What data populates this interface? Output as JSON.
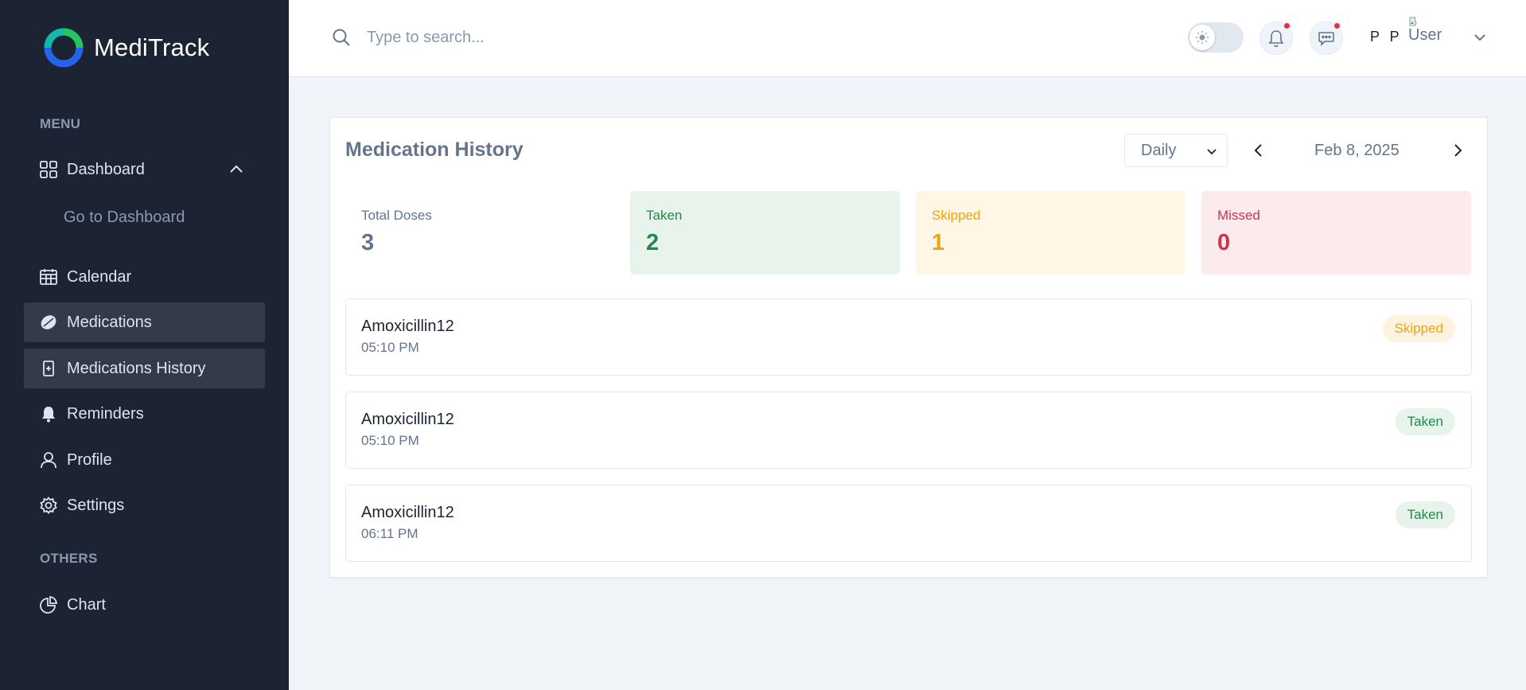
{
  "sidebar": {
    "brand": "MediTrack",
    "menu_title": "MENU",
    "others_title": "OTHERS",
    "items": [
      {
        "label": "Dashboard",
        "icon": "grid-icon"
      },
      {
        "label": "Go to Dashboard"
      },
      {
        "label": "Calendar",
        "icon": "calendar-icon"
      },
      {
        "label": "Medications",
        "icon": "pill-icon",
        "active": true
      },
      {
        "label": "Medications History",
        "icon": "history-icon",
        "active": true
      },
      {
        "label": "Reminders",
        "icon": "bell-icon"
      },
      {
        "label": "Profile",
        "icon": "user-icon"
      },
      {
        "label": "Settings",
        "icon": "gear-icon"
      },
      {
        "label": "Chart",
        "icon": "pie-chart-icon"
      }
    ]
  },
  "header": {
    "search_placeholder": "Type to search...",
    "user_initials": "P P",
    "avatar_alt": "User"
  },
  "main": {
    "title": "Medication History",
    "period": "Daily",
    "date": "Feb 8, 2025",
    "stats": {
      "total": {
        "label": "Total Doses",
        "value": "3"
      },
      "taken": {
        "label": "Taken",
        "value": "2"
      },
      "skipped": {
        "label": "Skipped",
        "value": "1"
      },
      "missed": {
        "label": "Missed",
        "value": "0"
      }
    },
    "entries": [
      {
        "name": "Amoxicillin12",
        "time": "05:10 PM",
        "status": "Skipped"
      },
      {
        "name": "Amoxicillin12",
        "time": "05:10 PM",
        "status": "Taken"
      },
      {
        "name": "Amoxicillin12",
        "time": "06:11 PM",
        "status": "Taken"
      }
    ]
  },
  "colors": {
    "sidebar_bg": "#1c2434",
    "taken": "#1f8a4c",
    "skipped": "#f0a30a",
    "missed": "#d0324a",
    "notification_dot": "#dc3545"
  }
}
